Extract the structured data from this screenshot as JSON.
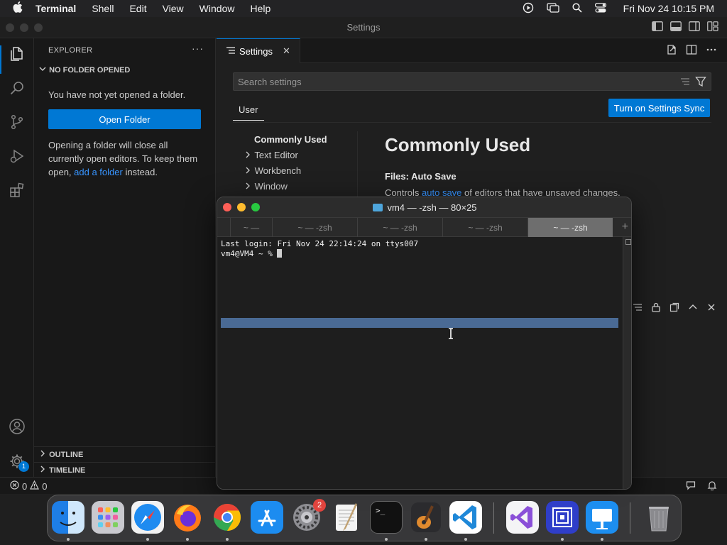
{
  "menubar": {
    "app_name": "Terminal",
    "items": [
      "Shell",
      "Edit",
      "View",
      "Window",
      "Help"
    ],
    "clock": "Fri Nov 24  10:15 PM"
  },
  "vscode": {
    "window_title": "Settings",
    "explorer": {
      "header": "EXPLORER",
      "more": "···",
      "section": "NO FOLDER OPENED",
      "message": "You have not yet opened a folder.",
      "open_folder_label": "Open Folder",
      "info_before": "Opening a folder will close all currently open editors. To keep them open, ",
      "info_link": "add a folder",
      "info_after": " instead.",
      "outline_label": "OUTLINE",
      "timeline_label": "TIMELINE"
    },
    "tab": {
      "label": "Settings",
      "close": "✕"
    },
    "settings": {
      "search_placeholder": "Search settings",
      "user_tab": "User",
      "sync_button": "Turn on Settings Sync",
      "toc": [
        "Commonly Used",
        "Text Editor",
        "Workbench",
        "Window"
      ],
      "title": "Commonly Used",
      "setting_category": "Files: ",
      "setting_name": "Auto Save",
      "desc_before": "Controls ",
      "desc_link": "auto save",
      "desc_after": " of editors that have unsaved changes."
    },
    "accounts_badge": "1",
    "status": {
      "errors": "0",
      "warnings": "0"
    }
  },
  "terminal": {
    "title": "vm4 — -zsh — 80×25",
    "tabs": [
      "~ —",
      "~ — -zsh",
      "~ — -zsh",
      "~ — -zsh",
      "~ — -zsh"
    ],
    "active_tab": 4,
    "plus": "+",
    "lines": [
      "Last login: Fri Nov 24 22:14:24 on ttys007",
      "vm4@VM4 ~ % "
    ]
  },
  "dock": {
    "system_settings_badge": "2",
    "terminal_prompt": ">_"
  },
  "colors": {
    "accent": "#0078d4",
    "link": "#3794ff",
    "close_light": "#fe5f57",
    "minimize_light": "#febc2e",
    "zoom_light": "#28c840"
  }
}
